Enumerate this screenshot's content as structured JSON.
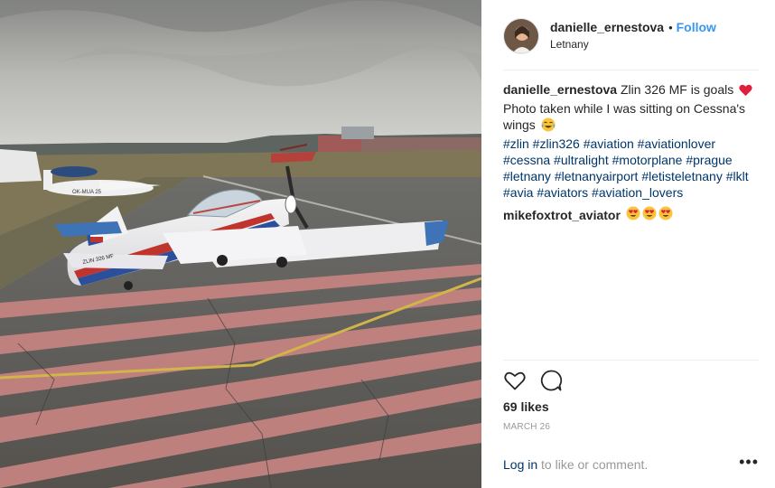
{
  "photo": {
    "subject": "Zlin 326 MF aircraft on tarmac",
    "registration": "ZLIN 326 MF"
  },
  "header": {
    "username": "danielle_ernestova",
    "separator": "•",
    "follow_label": "Follow",
    "location": "Letnany"
  },
  "caption": {
    "username": "danielle_ernestova",
    "text_part1": "Zlin 326 MF is goals",
    "text_part2": "Photo taken while I was sitting on Cessna's wings",
    "hashtags": "#zlin #zlin326 #aviation #aviationlover #cessna #ultralight #motorplane #prague #letnany #letnanyairport #letisteletnany #lklt #avia #aviators #aviation_lovers"
  },
  "comment": {
    "username": "mikefoxtrot_aviator"
  },
  "actions": {
    "like_icon": "heart-icon",
    "comment_icon": "comment-icon"
  },
  "likes": "69 likes",
  "date": "MARCH 26",
  "footer": {
    "login_label": "Log in",
    "login_rest": " to like or comment.",
    "more_label": "•••"
  },
  "colors": {
    "link": "#003569",
    "follow": "#3897f0",
    "muted": "#999999"
  }
}
